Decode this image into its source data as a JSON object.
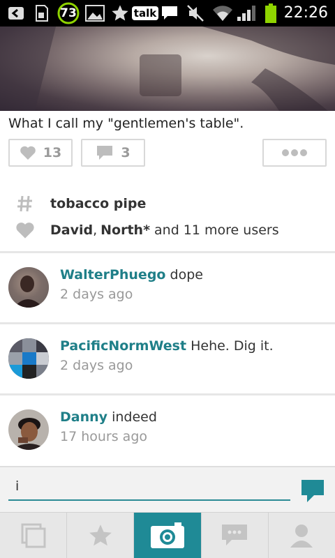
{
  "status_bar": {
    "time": "22:26",
    "notification_badge": "73",
    "talk_label": "talk",
    "battery_color": "#8fd400"
  },
  "post": {
    "caption": "What I call my \"gentlemen's table\".",
    "likes_count": "13",
    "comments_count": "3",
    "tag": "tobacco pipe",
    "likers": {
      "user1": "David",
      "separator": ",",
      "user2": "North*",
      "suffix": "and 11 more users"
    }
  },
  "comments": [
    {
      "user": "WalterPhuego",
      "text": "dope",
      "time": "2 days ago"
    },
    {
      "user": "PacificNormWest",
      "text": "Hehe. Dig it.",
      "time": "2 days ago"
    },
    {
      "user": "Danny",
      "text": "indeed",
      "time": "17 hours ago"
    }
  ],
  "input": {
    "value": "i"
  },
  "nav": {
    "items": [
      "feed-icon",
      "star-icon",
      "camera-icon",
      "chat-icon",
      "profile-icon"
    ],
    "active_index": 2
  },
  "colors": {
    "accent": "#1f7f88",
    "active_nav": "#1f8a96",
    "icon_gray": "#bdbdbd"
  }
}
